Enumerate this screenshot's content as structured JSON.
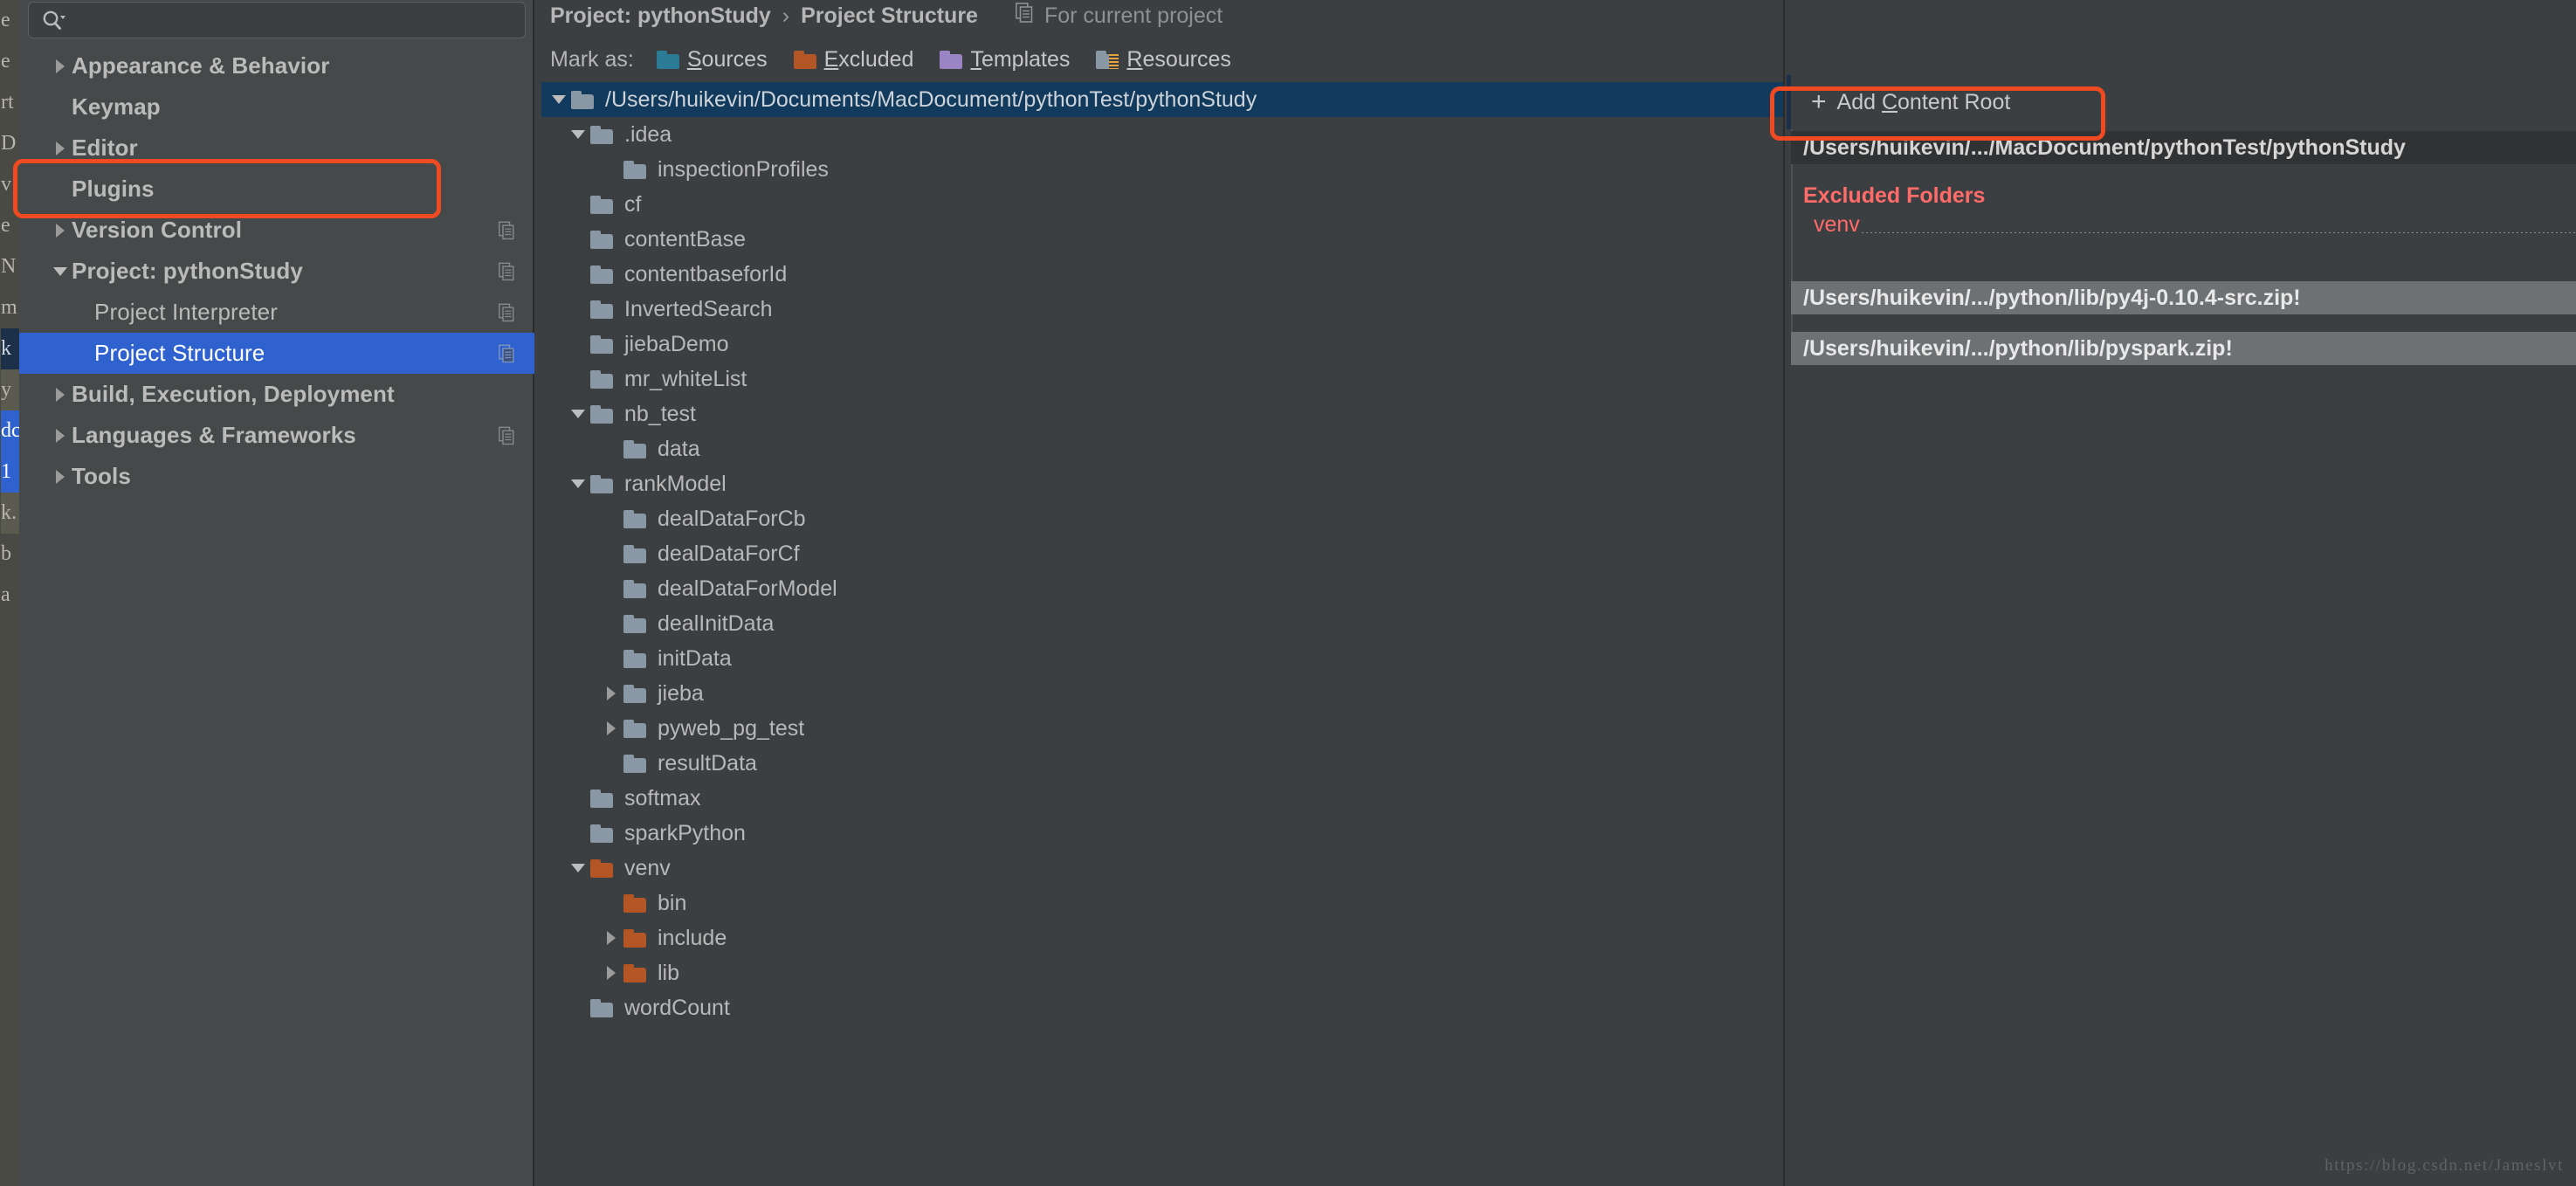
{
  "window": {
    "background_color": "#3c3f41",
    "accent_selection_color": "#2f62cf",
    "annotation_color": "#f04a22"
  },
  "search": {
    "icon": "search-icon",
    "value": "",
    "placeholder": ""
  },
  "sidebar": {
    "items": [
      {
        "label": "Appearance & Behavior",
        "twisty": "collapsed",
        "level": 0,
        "selected": false,
        "copy_icon": false
      },
      {
        "label": "Keymap",
        "twisty": "none",
        "level": 0,
        "selected": false,
        "copy_icon": false
      },
      {
        "label": "Editor",
        "twisty": "collapsed",
        "level": 0,
        "selected": false,
        "copy_icon": false
      },
      {
        "label": "Plugins",
        "twisty": "none",
        "level": 0,
        "selected": false,
        "copy_icon": false
      },
      {
        "label": "Version Control",
        "twisty": "collapsed",
        "level": 0,
        "selected": false,
        "copy_icon": true
      },
      {
        "label": "Project: pythonStudy",
        "twisty": "expanded",
        "level": 0,
        "selected": false,
        "copy_icon": true
      },
      {
        "label": "Project Interpreter",
        "twisty": "none",
        "level": 1,
        "selected": false,
        "copy_icon": true
      },
      {
        "label": "Project Structure",
        "twisty": "none",
        "level": 1,
        "selected": true,
        "copy_icon": true
      },
      {
        "label": "Build, Execution, Deployment",
        "twisty": "collapsed",
        "level": 0,
        "selected": false,
        "copy_icon": false
      },
      {
        "label": "Languages & Frameworks",
        "twisty": "collapsed",
        "level": 0,
        "selected": false,
        "copy_icon": true
      },
      {
        "label": "Tools",
        "twisty": "collapsed",
        "level": 0,
        "selected": false,
        "copy_icon": false
      }
    ]
  },
  "breadcrumb": {
    "project": "Project: pythonStudy",
    "separator": "›",
    "current": "Project Structure",
    "scope_icon": "copy-icon",
    "scope_note": "For current project"
  },
  "mark_as": {
    "label": "Mark as:",
    "buttons": [
      {
        "name": "sources",
        "text_before": "",
        "accel": "S",
        "text_after": "ources",
        "color": "#2b7a96"
      },
      {
        "name": "excluded",
        "text_before": "",
        "accel": "E",
        "text_after": "xcluded",
        "color": "#b45525"
      },
      {
        "name": "templates",
        "text_before": "",
        "accel": "T",
        "text_after": "emplates",
        "color": "#9b84c4"
      },
      {
        "name": "resources",
        "text_before": "",
        "accel": "R",
        "text_after": "esources",
        "color": "#8a98a5"
      }
    ]
  },
  "tree": {
    "rows": [
      {
        "label": "/Users/huikevin/Documents/MacDocument/pythonTest/pythonStudy",
        "indent": 0,
        "twisty": "expanded",
        "folder": "gray",
        "root": true
      },
      {
        "label": ".idea",
        "indent": 1,
        "twisty": "expanded",
        "folder": "gray",
        "root": false
      },
      {
        "label": "inspectionProfiles",
        "indent": 2,
        "twisty": "none",
        "folder": "gray",
        "root": false
      },
      {
        "label": "cf",
        "indent": 1,
        "twisty": "none",
        "folder": "gray",
        "root": false
      },
      {
        "label": "contentBase",
        "indent": 1,
        "twisty": "none",
        "folder": "gray",
        "root": false
      },
      {
        "label": "contentbaseforId",
        "indent": 1,
        "twisty": "none",
        "folder": "gray",
        "root": false
      },
      {
        "label": "InvertedSearch",
        "indent": 1,
        "twisty": "none",
        "folder": "gray",
        "root": false
      },
      {
        "label": "jiebaDemo",
        "indent": 1,
        "twisty": "none",
        "folder": "gray",
        "root": false
      },
      {
        "label": "mr_whiteList",
        "indent": 1,
        "twisty": "none",
        "folder": "gray",
        "root": false
      },
      {
        "label": "nb_test",
        "indent": 1,
        "twisty": "expanded",
        "folder": "gray",
        "root": false
      },
      {
        "label": "data",
        "indent": 2,
        "twisty": "none",
        "folder": "gray",
        "root": false
      },
      {
        "label": "rankModel",
        "indent": 1,
        "twisty": "expanded",
        "folder": "gray",
        "root": false
      },
      {
        "label": "dealDataForCb",
        "indent": 2,
        "twisty": "none",
        "folder": "gray",
        "root": false
      },
      {
        "label": "dealDataForCf",
        "indent": 2,
        "twisty": "none",
        "folder": "gray",
        "root": false
      },
      {
        "label": "dealDataForModel",
        "indent": 2,
        "twisty": "none",
        "folder": "gray",
        "root": false
      },
      {
        "label": "dealInitData",
        "indent": 2,
        "twisty": "none",
        "folder": "gray",
        "root": false
      },
      {
        "label": "initData",
        "indent": 2,
        "twisty": "none",
        "folder": "gray",
        "root": false
      },
      {
        "label": "jieba",
        "indent": 2,
        "twisty": "collapsed",
        "folder": "gray",
        "root": false
      },
      {
        "label": "pyweb_pg_test",
        "indent": 2,
        "twisty": "collapsed",
        "folder": "gray",
        "root": false
      },
      {
        "label": "resultData",
        "indent": 2,
        "twisty": "none",
        "folder": "gray",
        "root": false
      },
      {
        "label": "softmax",
        "indent": 1,
        "twisty": "none",
        "folder": "gray",
        "root": false
      },
      {
        "label": "sparkPython",
        "indent": 1,
        "twisty": "none",
        "folder": "gray",
        "root": false
      },
      {
        "label": "venv",
        "indent": 1,
        "twisty": "expanded",
        "folder": "orange",
        "root": false
      },
      {
        "label": "bin",
        "indent": 2,
        "twisty": "none",
        "folder": "orange",
        "root": false
      },
      {
        "label": "include",
        "indent": 2,
        "twisty": "collapsed",
        "folder": "orange",
        "root": false
      },
      {
        "label": "lib",
        "indent": 2,
        "twisty": "collapsed",
        "folder": "orange",
        "root": false
      },
      {
        "label": "wordCount",
        "indent": 1,
        "twisty": "none",
        "folder": "gray",
        "root": false
      }
    ]
  },
  "right_panel": {
    "add_content_root": {
      "plus": "+",
      "before": "Add ",
      "accel": "C",
      "after": "ontent Root"
    },
    "content_root_path": "/Users/huikevin/.../MacDocument/pythonTest/pythonStudy",
    "excluded_title": "Excluded Folders",
    "excluded_items": [
      "venv"
    ],
    "library_roots": [
      "/Users/huikevin/.../python/lib/py4j-0.10.4-src.zip!",
      "/Users/huikevin/.../python/lib/pyspark.zip!"
    ]
  },
  "edge_strip": {
    "chars": [
      "e",
      "e",
      "rt",
      "D",
      "v",
      "e",
      "N",
      "m",
      "k",
      "y",
      "dc",
      "1",
      "k.",
      "b",
      "a"
    ]
  },
  "watermark": "https://blog.csdn.net/Jameslvt"
}
